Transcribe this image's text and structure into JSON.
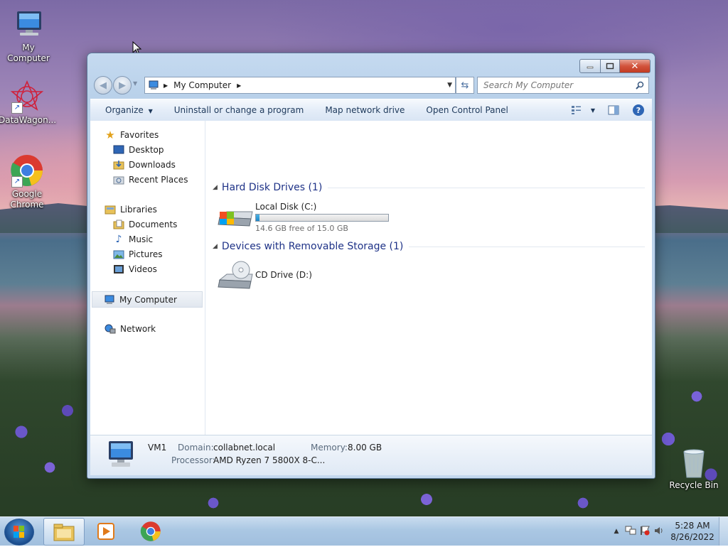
{
  "desktop": {
    "icons": [
      {
        "label": "My Computer"
      },
      {
        "label": "DataWagon..."
      },
      {
        "label": "Google Chrome"
      },
      {
        "label": "Recycle Bin"
      }
    ]
  },
  "window": {
    "address": {
      "breadcrumb": "My Computer"
    },
    "search": {
      "placeholder": "Search My Computer"
    },
    "toolbar": {
      "organize": "Organize",
      "uninstall": "Uninstall or change a program",
      "map_drive": "Map network drive",
      "control_panel": "Open Control Panel"
    },
    "navpane": {
      "favorites": "Favorites",
      "desktop": "Desktop",
      "downloads": "Downloads",
      "recent_places": "Recent Places",
      "libraries": "Libraries",
      "documents": "Documents",
      "music": "Music",
      "pictures": "Pictures",
      "videos": "Videos",
      "my_computer": "My Computer",
      "network": "Network"
    },
    "groups": {
      "hard_disk": {
        "title": "Hard Disk Drives (1)"
      },
      "removable": {
        "title": "Devices with Removable Storage (1)"
      }
    },
    "drives": {
      "c": {
        "name": "Local Disk (C:)",
        "free_text": "14.6 GB free of 15.0 GB",
        "used_fraction": 0.027
      },
      "d": {
        "name": "CD Drive (D:)"
      }
    },
    "details": {
      "name": "VM1",
      "domain_label": "Domain:",
      "domain": "collabnet.local",
      "memory_label": "Memory:",
      "memory": "8.00 GB",
      "processor_label": "Processor:",
      "processor": "AMD Ryzen 7 5800X 8-C..."
    }
  },
  "taskbar": {
    "time": "5:28 AM",
    "date": "8/26/2022"
  },
  "colors": {
    "accent": "#1e3287",
    "progress": "#1e86c7",
    "close": "#c23b23"
  }
}
